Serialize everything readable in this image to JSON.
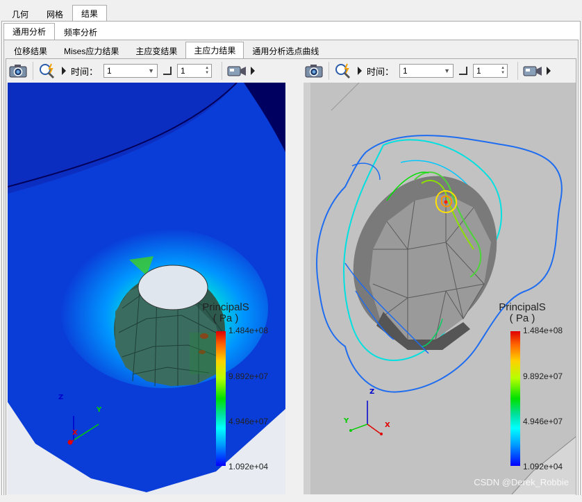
{
  "main_tabs": [
    "几何",
    "网格",
    "结果"
  ],
  "analysis_tabs": [
    "通用分析",
    "频率分析"
  ],
  "result_tabs": [
    "位移结果",
    "Mises应力结果",
    "主应变结果",
    "主应力结果",
    "通用分析选点曲线"
  ],
  "toolbar": {
    "time_label": "时间：",
    "time_value": "1",
    "step_value": "1"
  },
  "legend": {
    "title": "PrincipalS",
    "unit": "( Pa )",
    "ticks": [
      "1.484e+08",
      "9.892e+07",
      "4.946e+07",
      "1.092e+04"
    ]
  },
  "axes": {
    "x": "X",
    "y": "Y",
    "z": "Z"
  },
  "watermark": "CSDN @Derek_Robbie",
  "colors": {
    "accent_blue": "#0a3cd8",
    "deep_blue": "#00008b",
    "hole_green": "#2e5a4e",
    "grey_model": "#c0c0c0"
  }
}
